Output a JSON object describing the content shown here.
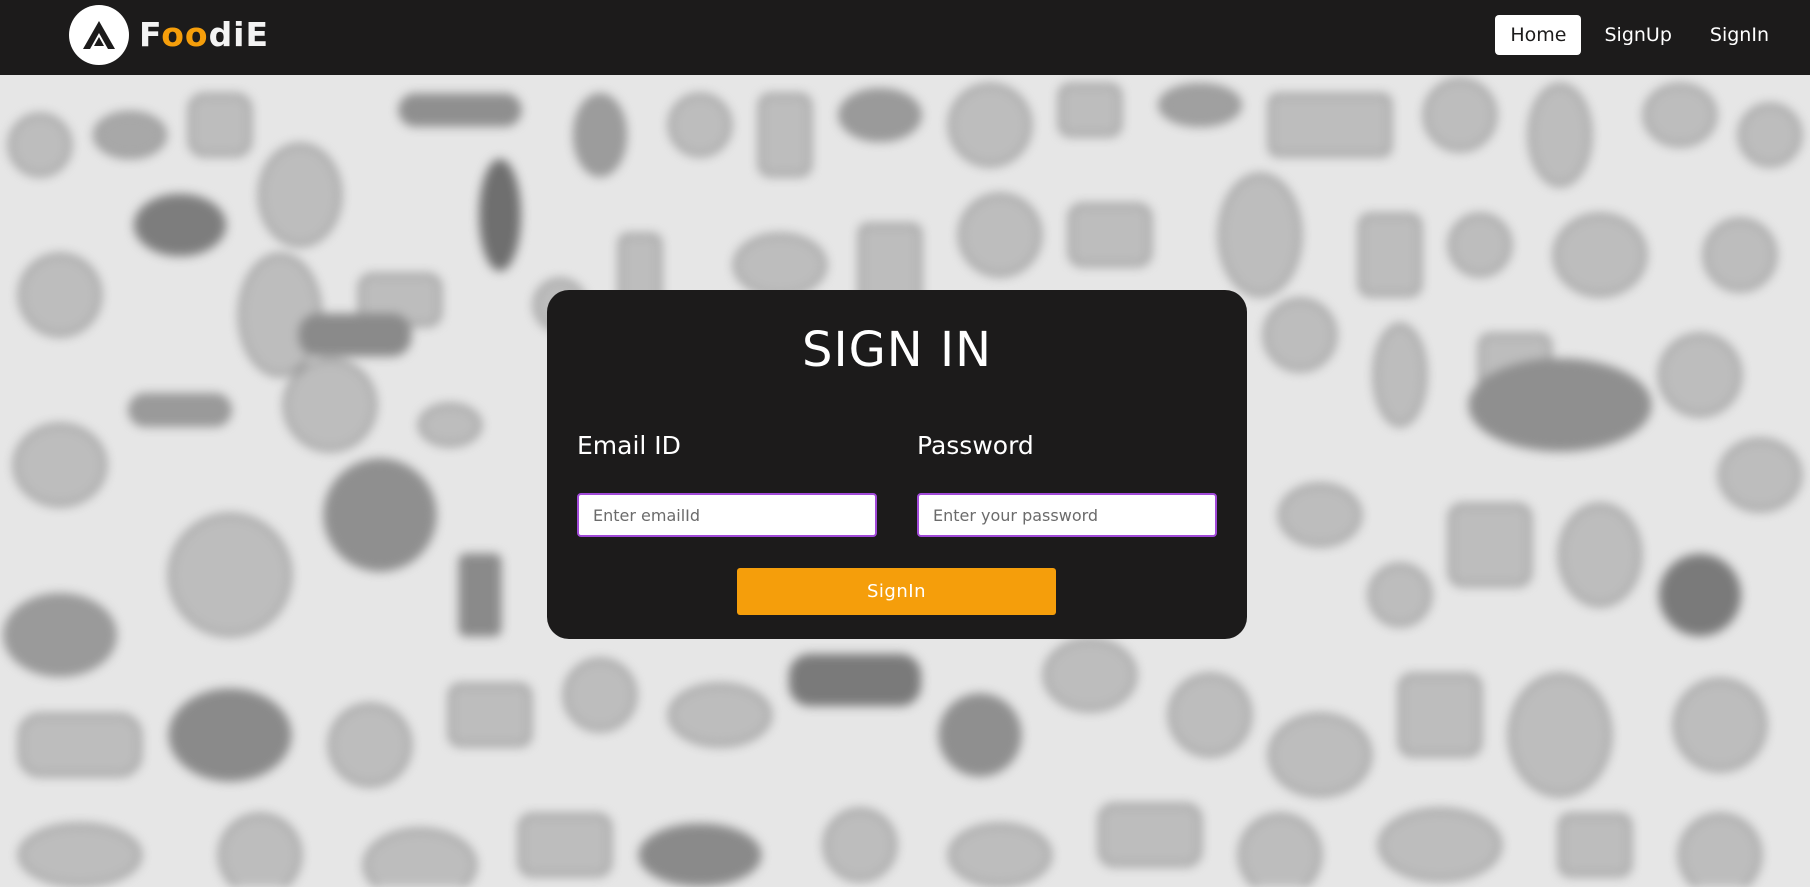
{
  "navbar": {
    "brand_first": "F",
    "brand_accent": "oo",
    "brand_rest": "diE",
    "logo_icon": "triangle-logo-icon",
    "links": [
      {
        "label": "Home",
        "active": true
      },
      {
        "label": "SignUp",
        "active": false
      },
      {
        "label": "SignIn",
        "active": false
      }
    ]
  },
  "form": {
    "title": "SIGN IN",
    "email_label": "Email ID",
    "email_placeholder": "Enter emailId",
    "password_label": "Password",
    "password_placeholder": "Enter your password",
    "submit_label": "SignIn"
  },
  "colors": {
    "dark": "#1c1b1b",
    "accent": "#f59e0b",
    "input_border": "#a14ad9",
    "background": "#e6e6e6"
  }
}
